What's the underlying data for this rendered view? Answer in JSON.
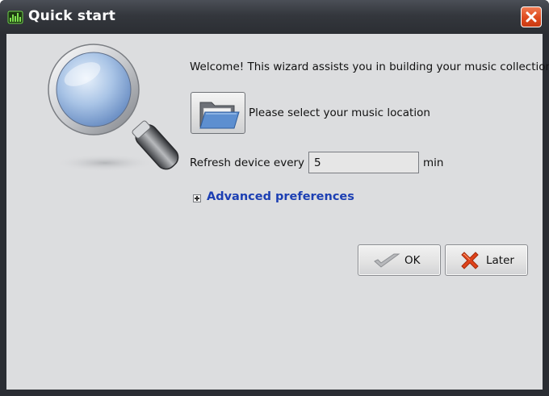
{
  "window": {
    "title": "Quick start",
    "app_icon": "equalizer-icon",
    "close_icon": "close-icon"
  },
  "wizard": {
    "welcome_text": "Welcome! This wizard assists you in building your music collection",
    "location_label": "Please select your music location",
    "folder_icon": "folder-icon",
    "refresh_label": "Refresh device every",
    "refresh_value": "5",
    "refresh_unit": "min",
    "advanced_label": "Advanced preferences",
    "advanced_expanded": false
  },
  "buttons": {
    "ok_label": "OK",
    "later_label": "Later"
  },
  "colors": {
    "titlebar": "#34373d",
    "client_bg": "#dcdddf",
    "link_blue": "#1c3fb3",
    "close_red": "#de4a1e"
  }
}
